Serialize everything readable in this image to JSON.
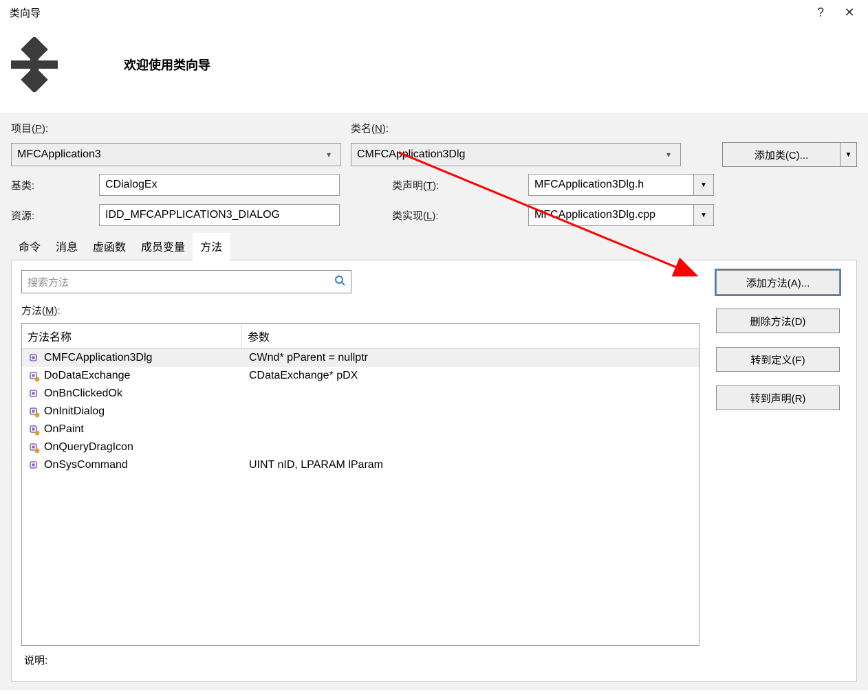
{
  "window": {
    "title": "类向导",
    "help": "?",
    "close": "✕"
  },
  "header": {
    "welcome": "欢迎使用类向导"
  },
  "labels": {
    "project": "项目(P):",
    "project_u": "P",
    "className": "类名(N):",
    "className_u": "N",
    "base": "基类:",
    "decl": "类声明(T):",
    "decl_u": "T",
    "resource": "资源:",
    "impl": "类实现(L):",
    "impl_u": "L",
    "methods": "方法(M):",
    "methods_u": "M",
    "description": "说明:"
  },
  "values": {
    "project": "MFCApplication3",
    "className": "CMFCApplication3Dlg",
    "base": "CDialogEx",
    "resource": "IDD_MFCAPPLICATION3_DIALOG",
    "decl": "MFCApplication3Dlg.h",
    "impl": "MFCApplication3Dlg.cpp"
  },
  "buttons": {
    "addClass": "添加类(C)...",
    "addMethod": "添加方法(A)...",
    "deleteMethod": "删除方法(D)",
    "gotoDef": "转到定义(F)",
    "gotoDecl": "转到声明(R)"
  },
  "tabs": {
    "items": [
      "命令",
      "消息",
      "虚函数",
      "成员变量",
      "方法"
    ],
    "active": 4
  },
  "search": {
    "placeholder": "搜索方法",
    "icon": "🔍"
  },
  "table": {
    "head": {
      "name": "方法名称",
      "params": "参数"
    },
    "rows": [
      {
        "name": "CMFCApplication3Dlg",
        "params": "CWnd* pParent = nullptr",
        "override": false,
        "selected": true
      },
      {
        "name": "DoDataExchange",
        "params": "CDataExchange* pDX",
        "override": true
      },
      {
        "name": "OnBnClickedOk",
        "params": "",
        "override": false
      },
      {
        "name": "OnInitDialog",
        "params": "",
        "override": true
      },
      {
        "name": "OnPaint",
        "params": "",
        "override": true
      },
      {
        "name": "OnQueryDragIcon",
        "params": "",
        "override": true
      },
      {
        "name": "OnSysCommand",
        "params": "UINT nID, LPARAM lParam",
        "override": false
      }
    ]
  }
}
